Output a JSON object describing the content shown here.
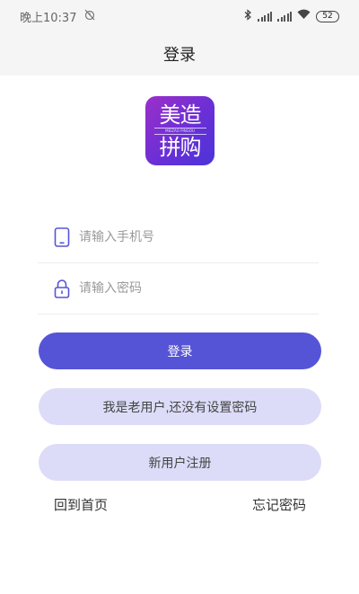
{
  "status_bar": {
    "time": "晚上10:37",
    "battery": "52"
  },
  "nav": {
    "title": "登录"
  },
  "logo": {
    "line1": "美造",
    "line2": "拼购",
    "sub": "MEIZAO PINGOU"
  },
  "form": {
    "phone_placeholder": "请输入手机号",
    "password_placeholder": "请输入密码",
    "phone_icon": "phone-icon",
    "lock_icon": "lock-icon"
  },
  "buttons": {
    "login": "登录",
    "old_user": "我是老用户,还没有设置密码",
    "register": "新用户注册"
  },
  "links": {
    "home": "回到首页",
    "forgot": "忘记密码"
  },
  "colors": {
    "primary": "#5654d6",
    "secondary_bg": "#dcdcf8",
    "logo_gradient_start": "#9c2fc9",
    "logo_gradient_end": "#4b34d9"
  }
}
